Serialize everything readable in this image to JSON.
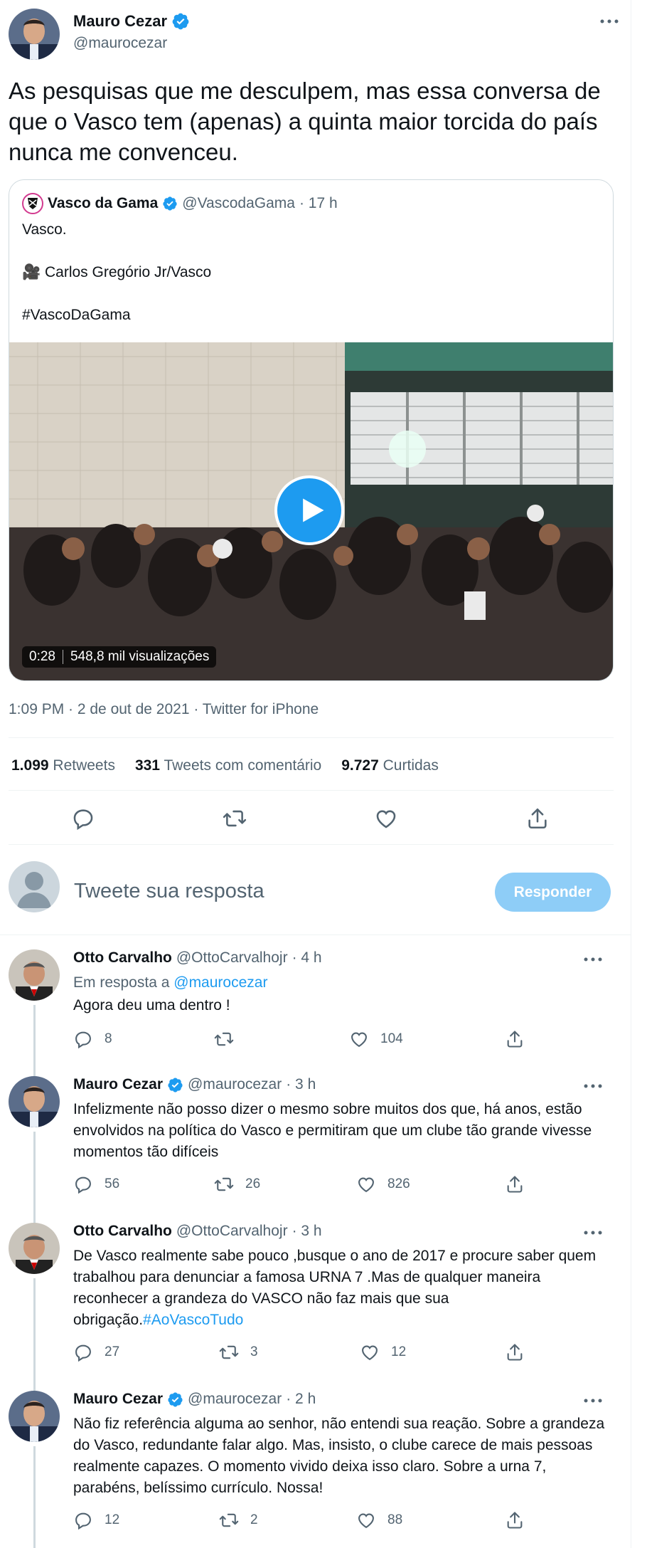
{
  "main_tweet": {
    "author_name": "Mauro Cezar",
    "author_handle": "@maurocezar",
    "text": "As pesquisas que me desculpem, mas essa conversa de que o Vasco tem (apenas) a quinta maior torcida do país nunca me convenceu.",
    "timestamp": "1:09 PM · 2 de out de 2021 · Twitter for iPhone",
    "stats": {
      "retweets_count": "1.099",
      "retweets_label": "Retweets",
      "quotes_count": "331",
      "quotes_label": "Tweets com comentário",
      "likes_count": "9.727",
      "likes_label": "Curtidas"
    }
  },
  "quoted_tweet": {
    "author_name": "Vasco da Gama",
    "author_handle": "@VascodaGama",
    "time": "· 17 h",
    "line1": "Vasco.",
    "line2": "🎥 Carlos Gregório Jr/Vasco",
    "line3": "#VascoDaGama",
    "video_duration": "0:28",
    "video_views": "548,8 mil visualizações"
  },
  "composer": {
    "placeholder": "Tweete sua resposta",
    "button_label": "Responder"
  },
  "replies": [
    {
      "author_name": "Otto Carvalho",
      "author_handle": "@OttoCarvalhojr",
      "time": "· 4 h",
      "reply_to_prefix": "Em resposta a",
      "reply_to_handle": "@maurocezar",
      "text": "Agora deu uma dentro !",
      "replies": "8",
      "retweets": "",
      "likes": "104"
    },
    {
      "author_name": "Mauro Cezar",
      "author_handle": "@maurocezar",
      "time": "· 3 h",
      "text": "Infelizmente não posso dizer o mesmo sobre muitos dos que, há anos, estão envolvidos na política do Vasco e permitiram que um clube tão grande vivesse momentos tão difíceis",
      "replies": "56",
      "retweets": "26",
      "likes": "826"
    },
    {
      "author_name": "Otto Carvalho",
      "author_handle": "@OttoCarvalhojr",
      "time": "· 3 h",
      "text": "De Vasco realmente sabe pouco ,busque o ano de 2017 e procure saber quem trabalhou para denunciar a famosa URNA 7 .Mas de qualquer maneira reconhecer a grandeza do VASCO não faz mais que sua obrigação.",
      "hashtag": "#AoVascoTudo",
      "replies": "27",
      "retweets": "3",
      "likes": "12"
    },
    {
      "author_name": "Mauro Cezar",
      "author_handle": "@maurocezar",
      "time": "· 2 h",
      "text": "Não fiz referência alguma ao senhor, não entendi sua reação. Sobre a grandeza do Vasco, redundante falar algo. Mas, insisto, o clube carece de mais pessoas realmente capazes. O momento vivido deixa isso claro. Sobre a urna 7, parabéns, belíssimo currículo. Nossa!",
      "replies": "12",
      "retweets": "2",
      "likes": "88"
    }
  ],
  "icons": {
    "verified": "verified-badge-icon",
    "more": "more-options-icon",
    "reply": "reply-icon",
    "retweet": "retweet-icon",
    "like": "like-icon",
    "share": "share-icon",
    "play": "play-icon"
  },
  "colors": {
    "accent": "#1d9bf0",
    "text": "#0f1419",
    "secondary": "#536471",
    "border": "#cfd9de"
  }
}
